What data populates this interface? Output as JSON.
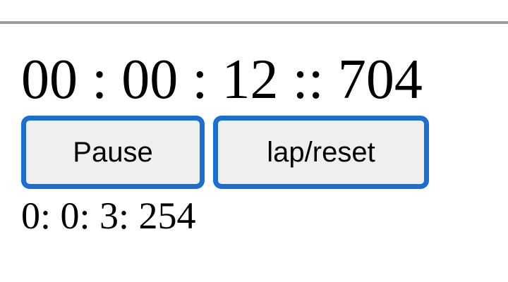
{
  "stopwatch": {
    "display": "00 : 00 : 12 :: 704"
  },
  "controls": {
    "pause_label": "Pause",
    "lap_reset_label": "lap/reset"
  },
  "laps": [
    "0: 0: 3: 254"
  ],
  "colors": {
    "button_border": "#1a6fd1",
    "button_background": "#efefef",
    "top_rule": "#9e9e9e"
  }
}
